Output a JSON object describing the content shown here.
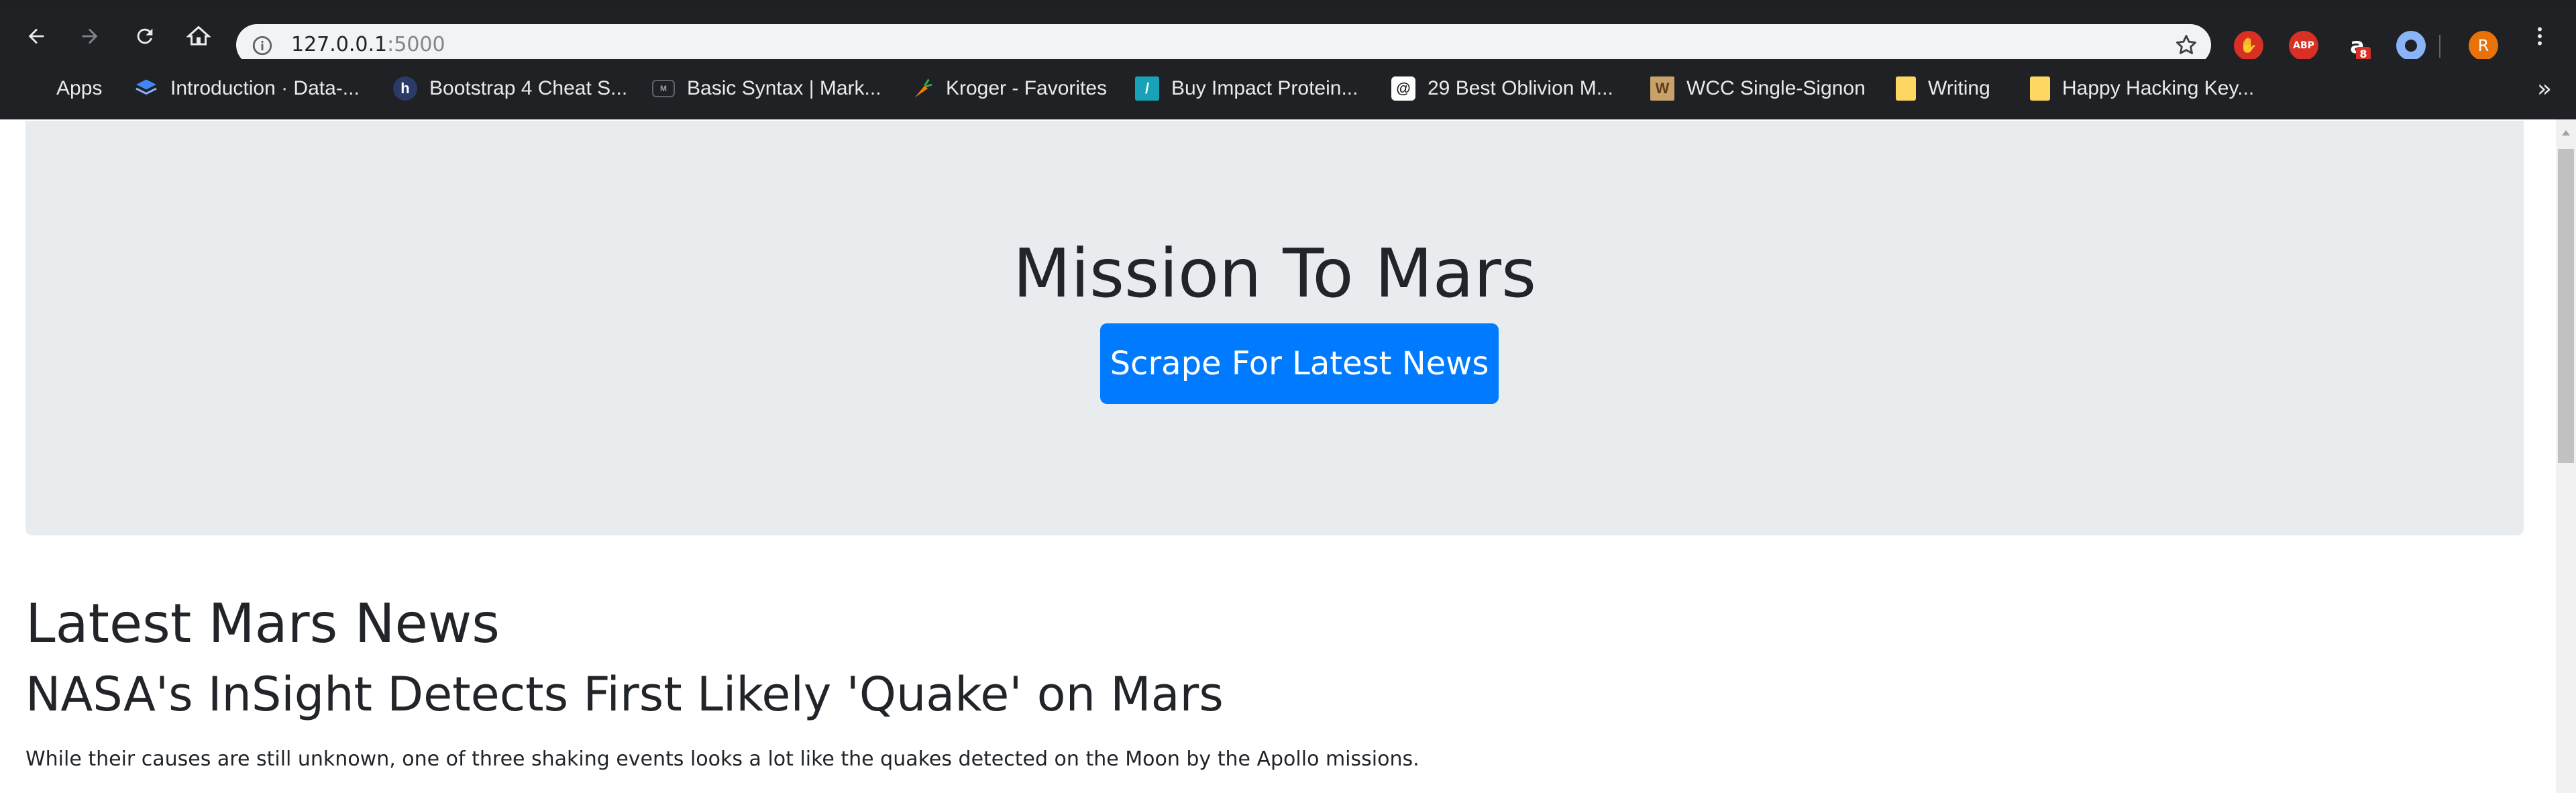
{
  "browser": {
    "url_host": "127.0.0.1",
    "url_port": ":5000",
    "profile_initial": "R",
    "amazon_badge": "8",
    "abp_label": "ABP"
  },
  "bookmarks": {
    "items": [
      {
        "label": "Apps",
        "icon": "apps-grid-icon"
      },
      {
        "label": "Introduction · Data-...",
        "icon": "layers-icon"
      },
      {
        "label": "Bootstrap 4 Cheat S...",
        "icon": "h-badge-icon"
      },
      {
        "label": "Basic Syntax | Mark...",
        "icon": "markdown-icon"
      },
      {
        "label": "Kroger - Favorites",
        "icon": "carrot-icon"
      },
      {
        "label": "Buy Impact Protein...",
        "icon": "slash-tile-icon"
      },
      {
        "label": "29 Best Oblivion M...",
        "icon": "swirl-icon"
      },
      {
        "label": "WCC Single-Signon",
        "icon": "wcc-logo-icon"
      },
      {
        "label": "Writing",
        "icon": "folder-icon"
      },
      {
        "label": "Happy Hacking Key...",
        "icon": "folder-icon"
      }
    ],
    "more_label": "»"
  },
  "jumbotron": {
    "title": "Mission To Mars",
    "button_label": "Scrape For Latest News"
  },
  "news": {
    "heading": "Latest Mars News",
    "title": "NASA's InSight Detects First Likely 'Quake' on Mars",
    "paragraph": "While their causes are still unknown, one of three shaking events looks a lot like the quakes detected on the Moon by the Apollo missions."
  },
  "colors": {
    "primary": "#007bff",
    "jumbotron_bg": "#e9ecef",
    "chrome_bg": "#202124"
  }
}
